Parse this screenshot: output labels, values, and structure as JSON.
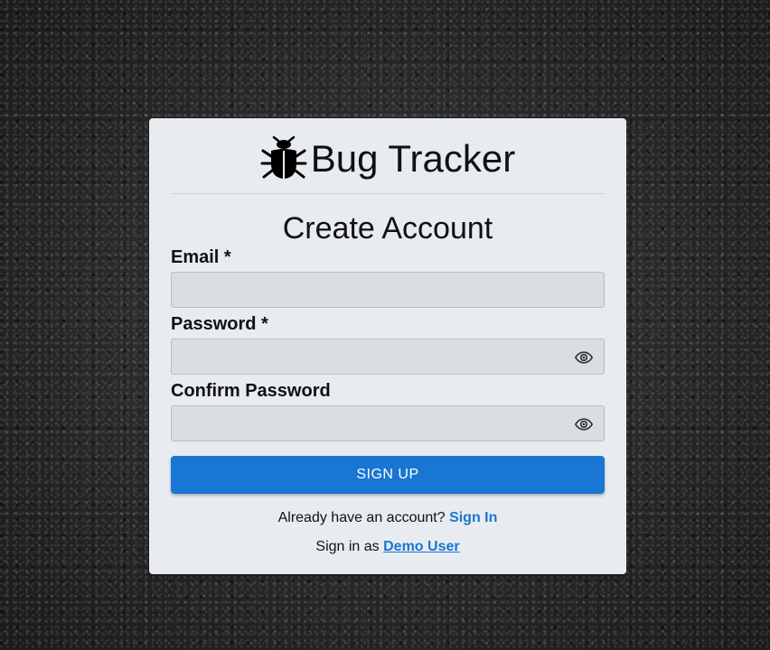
{
  "app": {
    "title": "Bug Tracker",
    "logo_icon": "bug-icon"
  },
  "form": {
    "heading": "Create Account",
    "email_label": "Email *",
    "email_value": "",
    "password_label": "Password *",
    "password_value": "",
    "password_toggle_icon": "eye-icon",
    "confirm_label": "Confirm Password",
    "confirm_value": "",
    "confirm_toggle_icon": "eye-icon",
    "submit_label": "SIGN UP"
  },
  "footer": {
    "have_account_text": "Already have an account?",
    "sign_in_link": "Sign In",
    "demo_prefix": "Sign in as",
    "demo_link": "Demo User"
  },
  "colors": {
    "primary": "#1976d2",
    "card_bg": "#e8ebef",
    "field_bg": "#dadde1"
  }
}
